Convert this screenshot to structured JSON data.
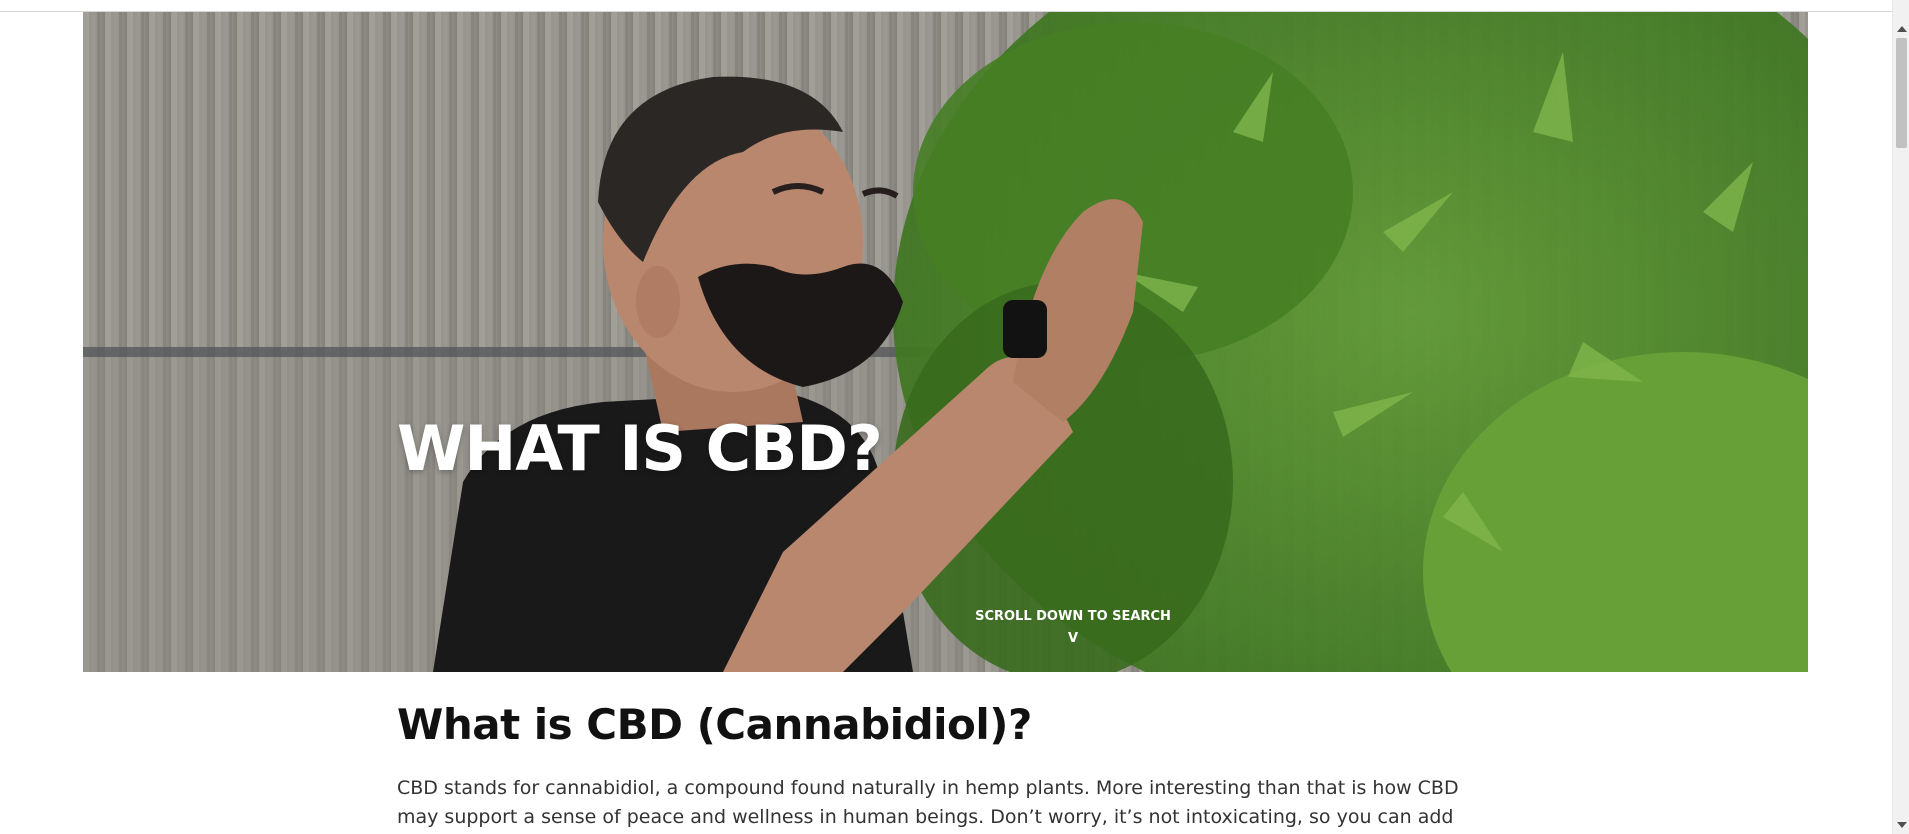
{
  "hero": {
    "title": "WHAT IS CBD?",
    "scroll_hint": "SCROLL DOWN TO SEARCH",
    "scroll_chevron": "V",
    "image_subject": "man inspecting hemp plants in greenhouse"
  },
  "article": {
    "heading": "What is CBD (Cannabidiol)?",
    "paragraph": "CBD stands for cannabidiol, a compound found naturally in hemp plants. More interesting than that is how CBD may support a sense of peace and wellness in human beings. Don’t worry, it’s not intoxicating, so you can add"
  },
  "colors": {
    "heading": "#111111",
    "body_text": "#333333",
    "hero_text": "#ffffff",
    "plant_green": "#4f8a2b"
  }
}
